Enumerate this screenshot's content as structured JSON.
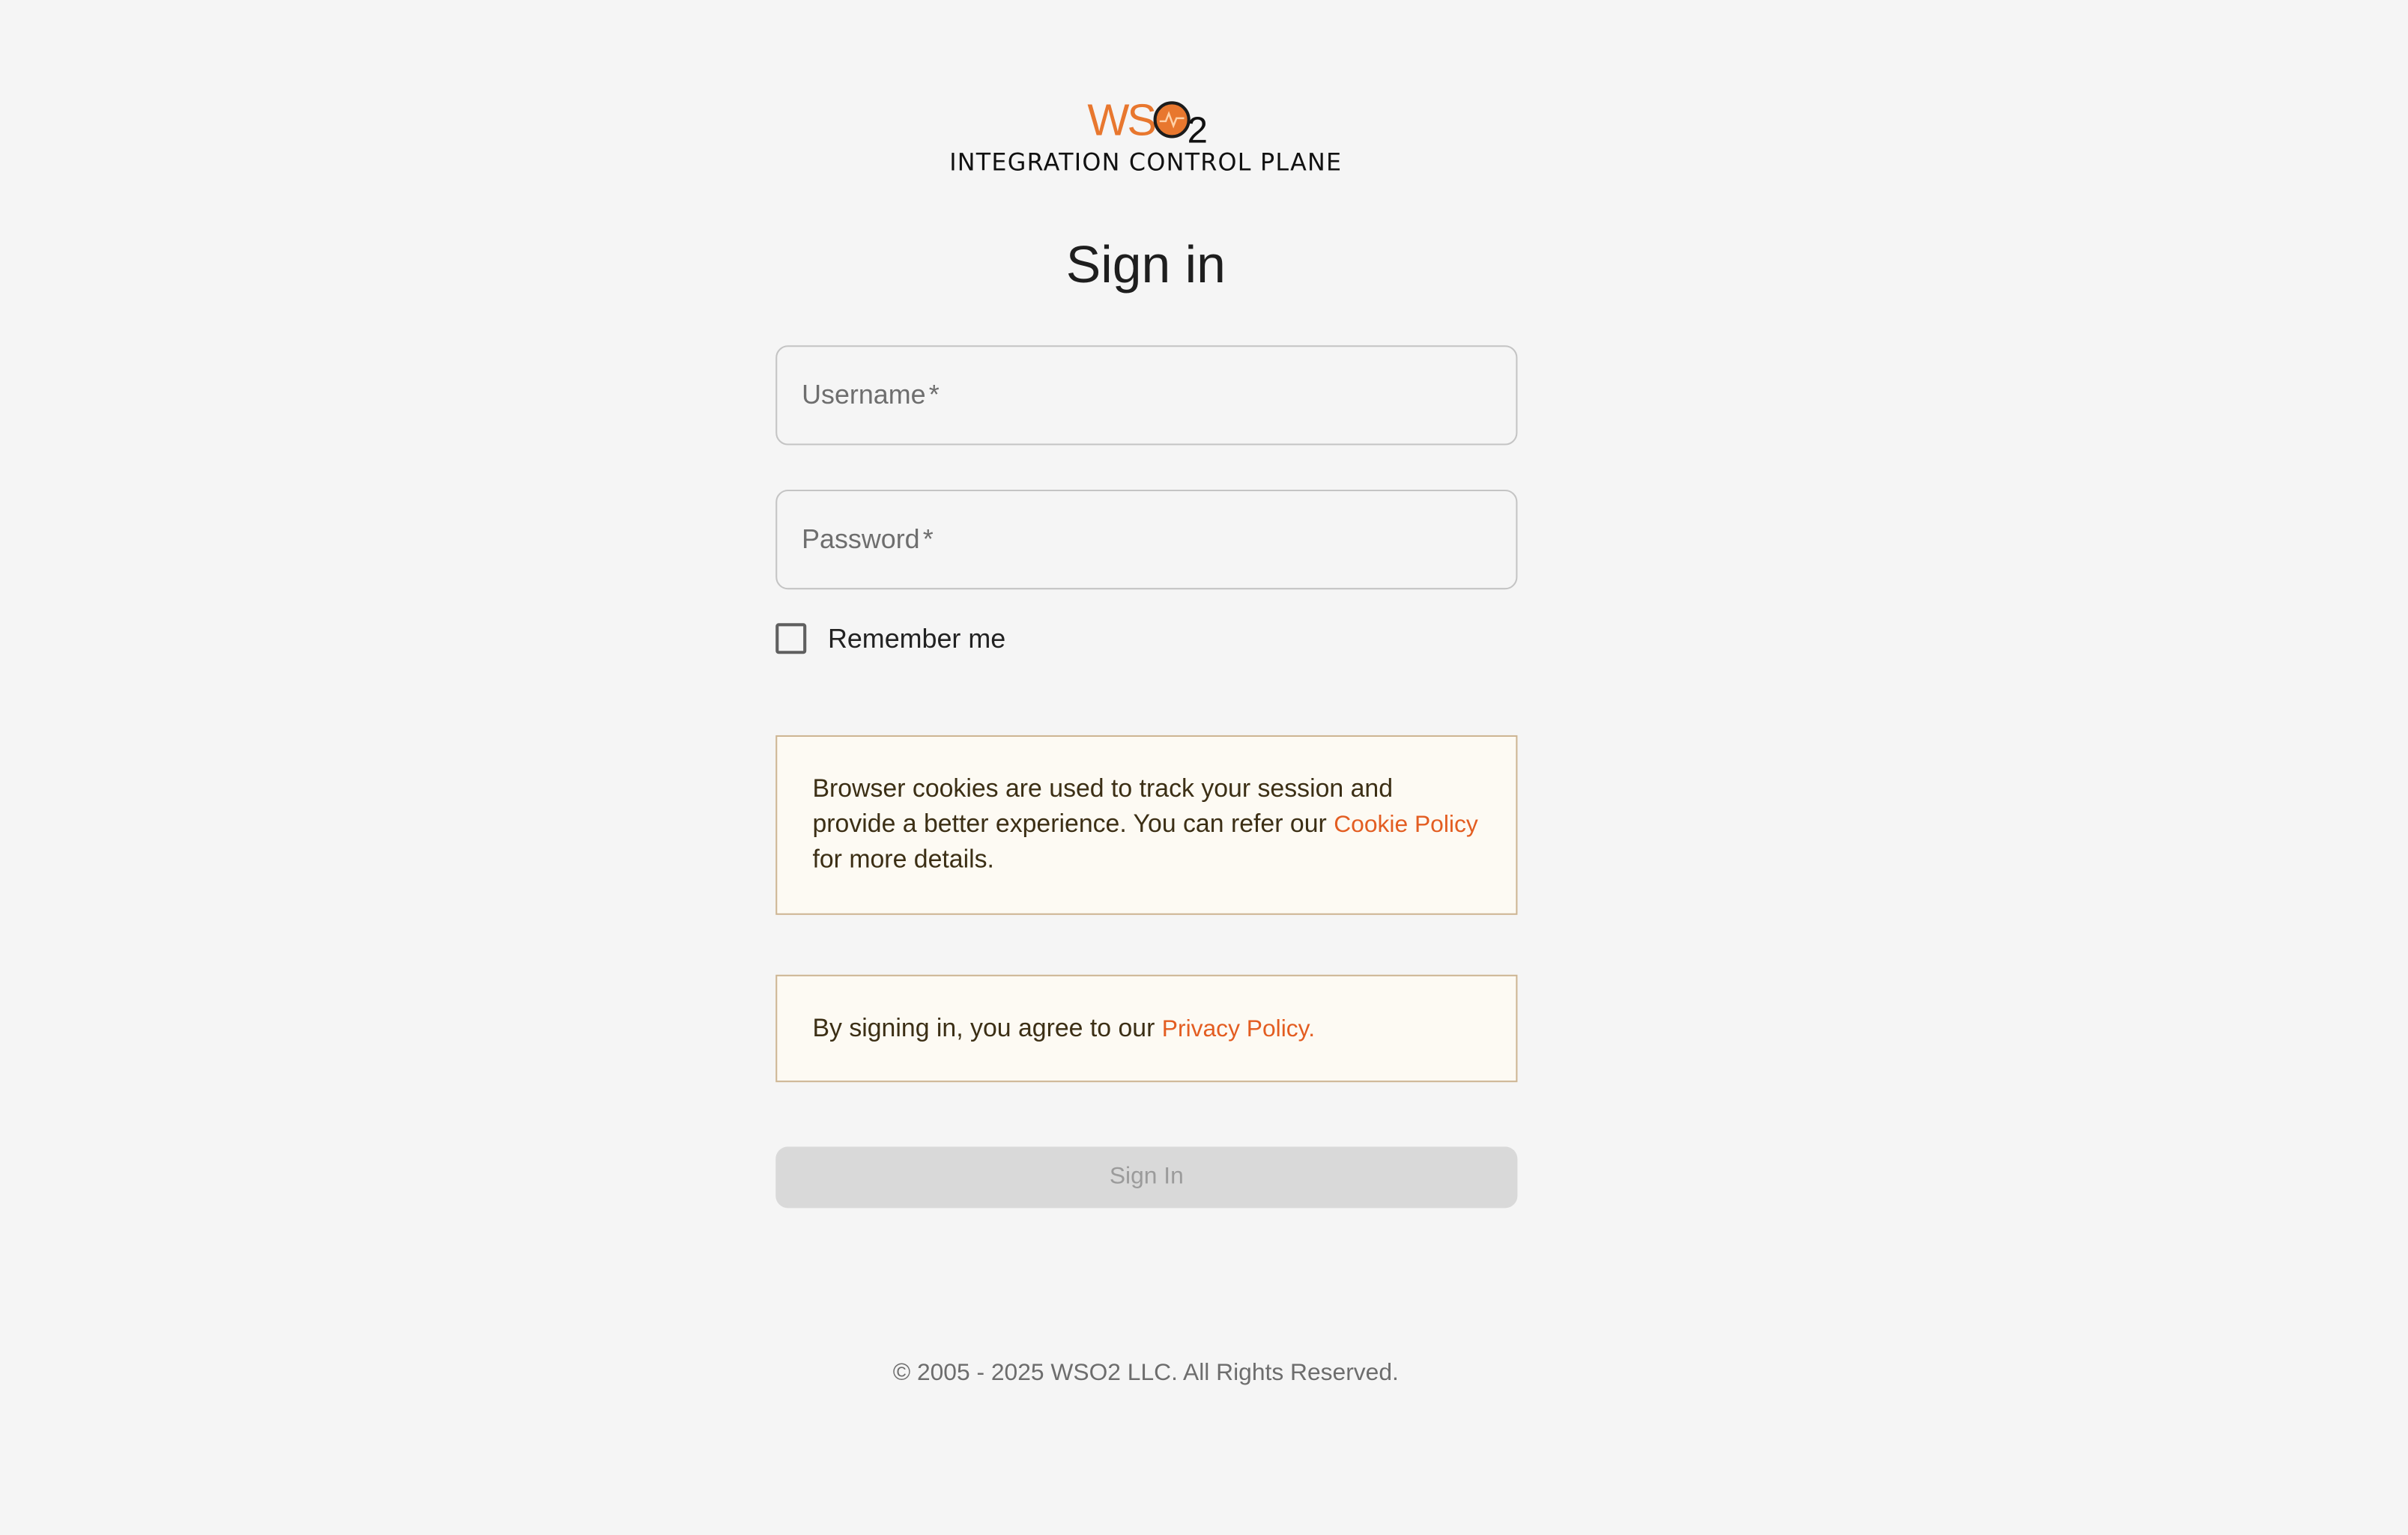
{
  "logo": {
    "wordmark": "WSO",
    "subscript": "2",
    "icon": "pulse-circle-icon",
    "colors": {
      "orange": "#e8772e",
      "dark": "#1c1c1c"
    }
  },
  "app": {
    "subtitle": "INTEGRATION CONTROL PLANE"
  },
  "page": {
    "heading": "Sign in"
  },
  "form": {
    "username_label": "Username",
    "password_label": "Password",
    "required_marker": "*",
    "remember_label": "Remember me",
    "remember_checked": false,
    "submit_label": "Sign In",
    "submit_disabled": true
  },
  "cookie_notice": {
    "text_before": "Browser cookies are used to track your session and provide a better experience. You can refer our",
    "link": "Cookie Policy",
    "text_after": "for more details."
  },
  "privacy_notice": {
    "text_before": "By signing in, you agree to our",
    "link": "Privacy Policy."
  },
  "footer": {
    "copyright": "© 2005 - 2025 WSO2 LLC. All Rights Reserved."
  },
  "colors": {
    "background": "#f5f5f5",
    "link": "#e35d21",
    "notice_border": "#cdb593",
    "notice_background": "#fdfaf3",
    "button_disabled": "#d9d9d9"
  }
}
